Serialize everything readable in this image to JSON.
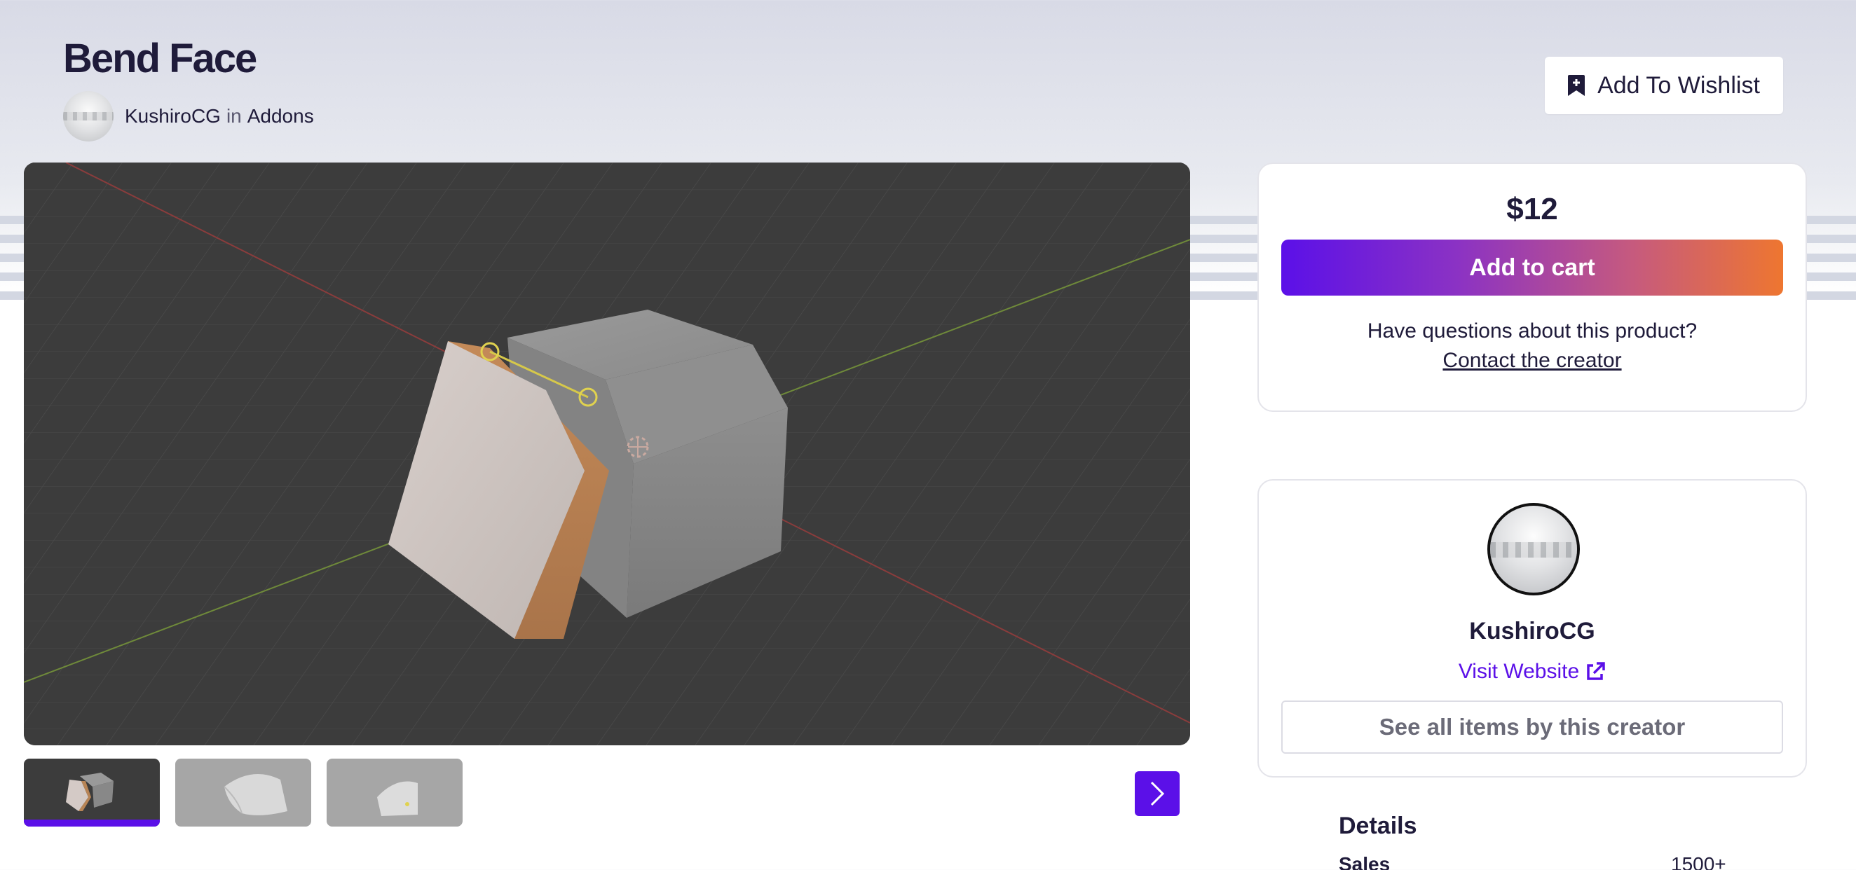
{
  "product": {
    "title": "Bend Face",
    "creator": "KushiroCG",
    "in_word": "in",
    "category": "Addons"
  },
  "wishlist": {
    "label": "Add To Wishlist",
    "icon": "bookmark-plus-icon"
  },
  "purchase": {
    "price": "$12",
    "add_to_cart": "Add to cart",
    "question": "Have questions about this product?",
    "contact": "Contact the creator"
  },
  "creator_card": {
    "name": "KushiroCG",
    "visit_website": "Visit Website",
    "see_all": "See all items by this creator"
  },
  "details": {
    "title": "Details",
    "sales_label": "Sales",
    "sales_value": "1500+"
  },
  "gallery": {
    "thumbnail_count": 3,
    "active_index": 0,
    "next_icon": "chevron-right-icon"
  },
  "colors": {
    "accent": "#5b10e8",
    "gradient_end": "#ee7630",
    "viewport_bg": "#3c3c3c"
  }
}
